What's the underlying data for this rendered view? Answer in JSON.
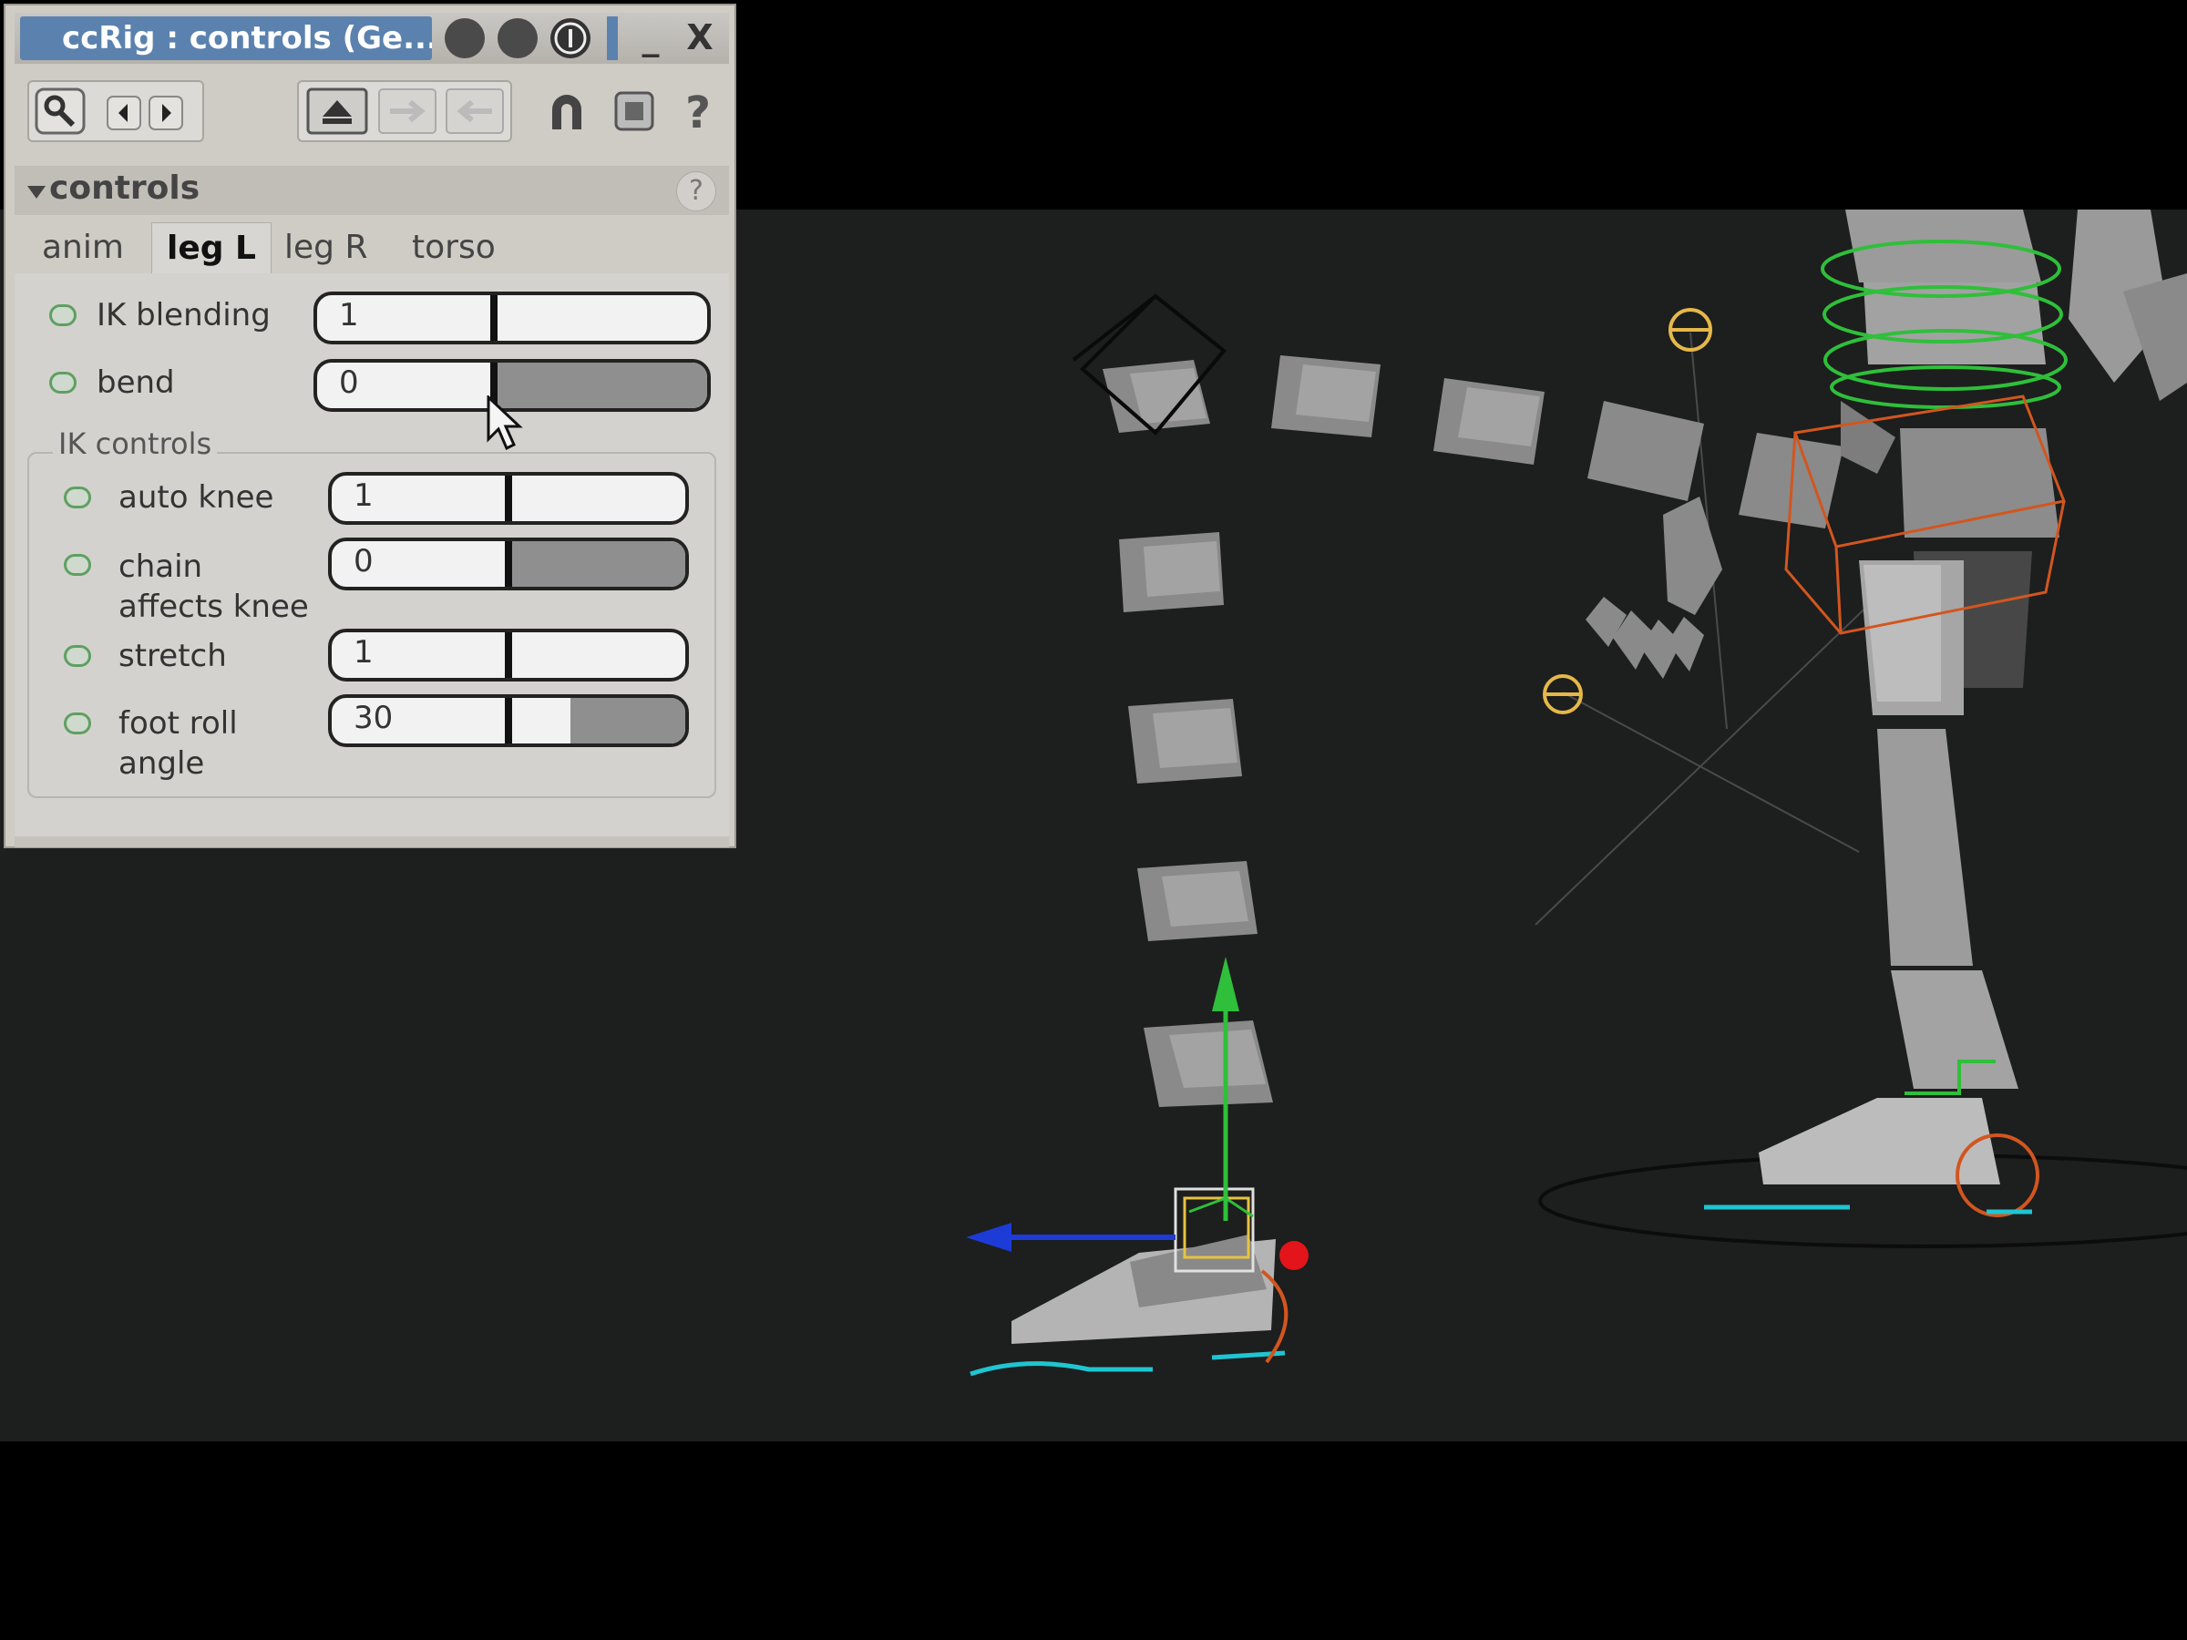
{
  "window": {
    "title": "ccRig : controls (Ge...",
    "minimize_label": "_",
    "close_label": "X"
  },
  "toolbar": {
    "help_label": "?"
  },
  "section": {
    "label": "controls",
    "help_label": "?"
  },
  "tabs": [
    {
      "label": "anim",
      "active": false
    },
    {
      "label": "leg L",
      "active": true
    },
    {
      "label": "leg R",
      "active": false
    },
    {
      "label": "torso",
      "active": false
    }
  ],
  "rows": {
    "ik_blending": {
      "label": "IK blending",
      "value": "1"
    },
    "bend": {
      "label": "bend",
      "value": "0"
    }
  },
  "ik_controls": {
    "group_label": "IK controls",
    "auto_knee": {
      "label": "auto knee",
      "value": "1"
    },
    "chain_affects_knee": {
      "label_line1": "chain",
      "label_line2": "affects knee",
      "value": "0"
    },
    "stretch": {
      "label": "stretch",
      "value": "1"
    },
    "foot_roll_angle": {
      "label_line1": "foot roll",
      "label_line2": "angle",
      "value": "30"
    }
  },
  "colors": {
    "title_bar": "#5b82ae",
    "panel_bg": "#cfccc6",
    "viewport_bg": "#1d1e1e",
    "led_green": "#5ea062",
    "rig_green": "#2fbf3a",
    "rig_orange": "#d2561f",
    "rig_cyan": "#1fc5d1",
    "rig_yellow": "#e5b84a",
    "axis_blue": "#1d3bd6",
    "axis_red": "#e3141a"
  },
  "icons": [
    "wrench-icon",
    "arrow-left-icon",
    "arrow-right-icon",
    "shelf-up-icon",
    "shelf-right-icon",
    "shelf-left-icon",
    "magnet-icon",
    "select-icon",
    "help-icon",
    "globe-icon",
    "gear-icon",
    "info-icon",
    "chevron-down-icon",
    "mouse-cursor-icon"
  ]
}
